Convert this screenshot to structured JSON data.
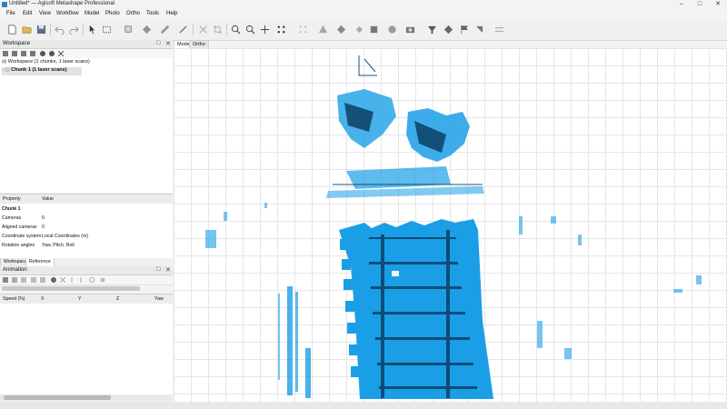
{
  "title_bar": {
    "title": "Untitled* — Agisoft Metashape Professional"
  },
  "menu": [
    {
      "label": "File"
    },
    {
      "label": "Edit"
    },
    {
      "label": "View"
    },
    {
      "label": "Workflow"
    },
    {
      "label": "Model"
    },
    {
      "label": "Photo"
    },
    {
      "label": "Ortho"
    },
    {
      "label": "Tools"
    },
    {
      "label": "Help"
    }
  ],
  "workspace": {
    "header": "Workspace",
    "root": "Workspace (1 chunks, 1 laser scans)",
    "chunk": "Chunk 1 (1 laser scans)"
  },
  "properties": {
    "col_property": "Property",
    "col_value": "Value",
    "section": "Chunk 1",
    "rows": [
      {
        "name": "Cameras",
        "value": "0"
      },
      {
        "name": "Aligned cameras",
        "value": "0"
      },
      {
        "name": "Coordinate system",
        "value": "Local Coordinates (m)"
      },
      {
        "name": "Rotation angles",
        "value": "Yaw, Pitch, Roll"
      }
    ]
  },
  "bottom_tabs": {
    "workspace": "Workspace",
    "reference": "Reference"
  },
  "animation": {
    "header": "Animation",
    "columns": [
      "Speed (%)",
      "X",
      "Y",
      "Z",
      "Yaw"
    ]
  },
  "view_tabs": {
    "model": "Model",
    "ortho": "Ortho"
  },
  "colors": {
    "point_cloud": "#1a9fe6",
    "accent": "#2f7fd0",
    "selected_row": "#e3e3e3"
  }
}
